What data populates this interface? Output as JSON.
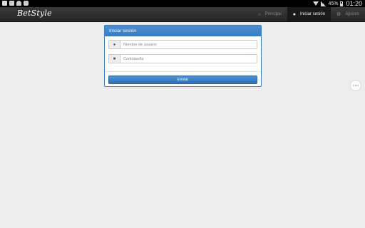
{
  "status_bar": {
    "icons_left": [
      "facebook-icon",
      "gallery-icon",
      "cloud-icon",
      "camera-icon"
    ],
    "battery": "45%",
    "time": "01:20"
  },
  "navbar": {
    "logo": "BetStyle",
    "items": [
      {
        "label": "Principal",
        "icon": "home-icon",
        "active": false
      },
      {
        "label": "Iniciar sesión",
        "icon": "user-icon",
        "active": true
      },
      {
        "label": "Ajustes",
        "icon": "gear-icon",
        "active": false
      }
    ]
  },
  "login": {
    "title": "Iniciar sesión",
    "username_placeholder": "Nombre de usuario",
    "password_placeholder": "Contraseña",
    "submit_label": "Enviar"
  },
  "colors": {
    "panel_header": "#3a7bc0",
    "navbar": "#2a2a2a",
    "background": "#ececec"
  }
}
